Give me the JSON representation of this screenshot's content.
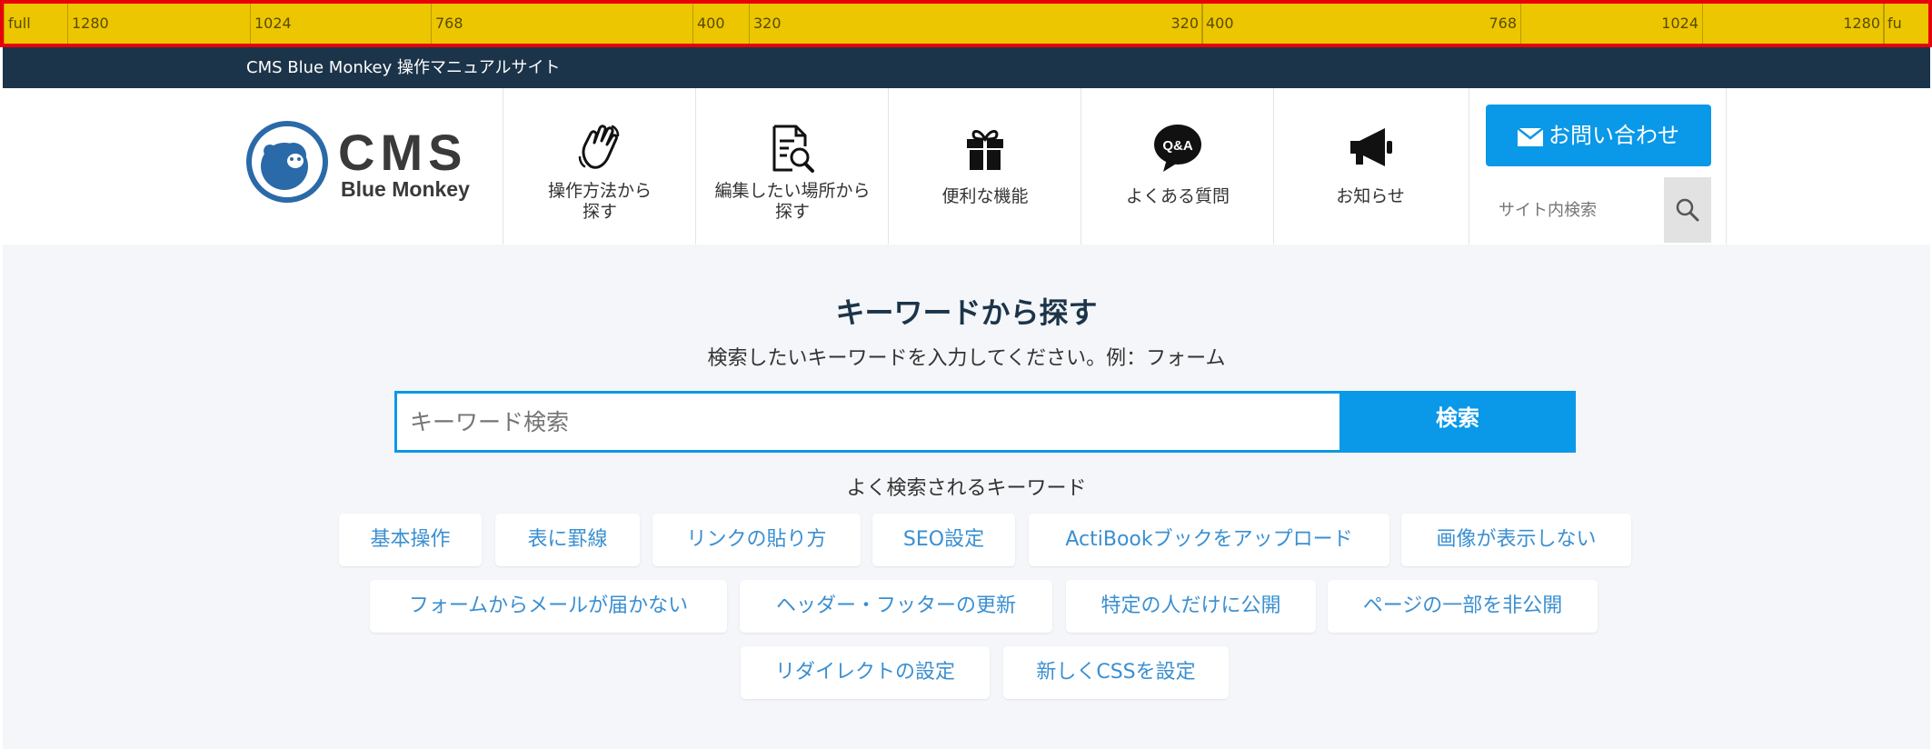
{
  "ruler": {
    "left": [
      "full",
      "1280",
      "1024",
      "768",
      "400",
      "320"
    ],
    "right": [
      "320",
      "400",
      "768",
      "1024",
      "1280",
      "fu"
    ]
  },
  "topbar": {
    "title": "CMS Blue Monkey 操作マニュアルサイト"
  },
  "logo": {
    "main": "CMS",
    "sub": "Blue Monkey"
  },
  "nav": [
    {
      "icon": "hand-wave-icon",
      "label": "操作方法から\n探す"
    },
    {
      "icon": "document-search-icon",
      "label": "編集したい場所から\n探す"
    },
    {
      "icon": "gift-icon",
      "label": "便利な機能"
    },
    {
      "icon": "qa-bubble-icon",
      "label": "よくある質問"
    },
    {
      "icon": "megaphone-icon",
      "label": "お知らせ"
    }
  ],
  "contact": {
    "label": "お問い合わせ",
    "icon": "mail-icon"
  },
  "site_search": {
    "placeholder": "サイト内検索",
    "icon": "search-icon"
  },
  "main": {
    "heading": "キーワードから探す",
    "subheading": "検索したいキーワードを入力してください。例：フォーム",
    "input_placeholder": "キーワード検索",
    "search_button": "検索",
    "popular_label": "よく検索されるキーワード",
    "tags": [
      "基本操作",
      "表に罫線",
      "リンクの貼り方",
      "SEO設定",
      "ActiBookブックをアップロード",
      "画像が表示しない",
      "フォームからメールが届かない",
      "ヘッダー・フッターの更新",
      "特定の人だけに公開",
      "ページの一部を非公開",
      "リダイレクトの設定",
      "新しくCSSを設定"
    ]
  },
  "colors": {
    "accent": "#0a98e8",
    "topbar": "#1c3449",
    "ruler": "#ecc600",
    "ruler_border": "#e8000c",
    "main_bg": "#f4f6f9",
    "tag_text": "#3a8fd1"
  }
}
